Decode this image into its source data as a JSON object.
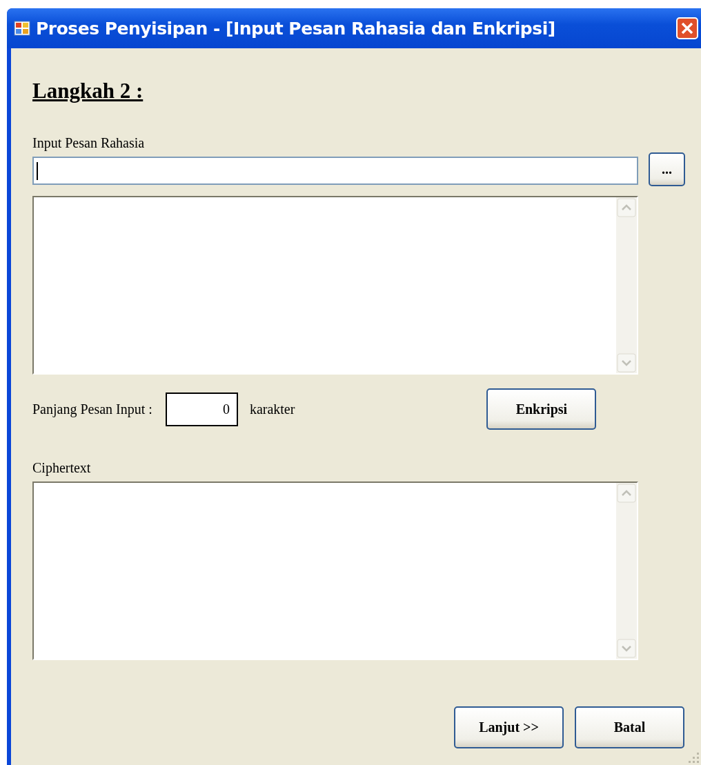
{
  "window": {
    "title": "Proses Penyisipan - [Input Pesan Rahasia dan Enkripsi]"
  },
  "heading": "Langkah 2 :",
  "message": {
    "label": "Input Pesan Rahasia",
    "input_focused": true,
    "browse_button": "..."
  },
  "length": {
    "label": "Panjang Pesan Input :",
    "value": "0",
    "unit": "karakter"
  },
  "encrypt_button": "Enkripsi",
  "ciphertext": {
    "label": "Ciphertext"
  },
  "buttons": [
    {
      "label": "Lanjut >>"
    },
    {
      "label": "Batal"
    }
  ]
}
